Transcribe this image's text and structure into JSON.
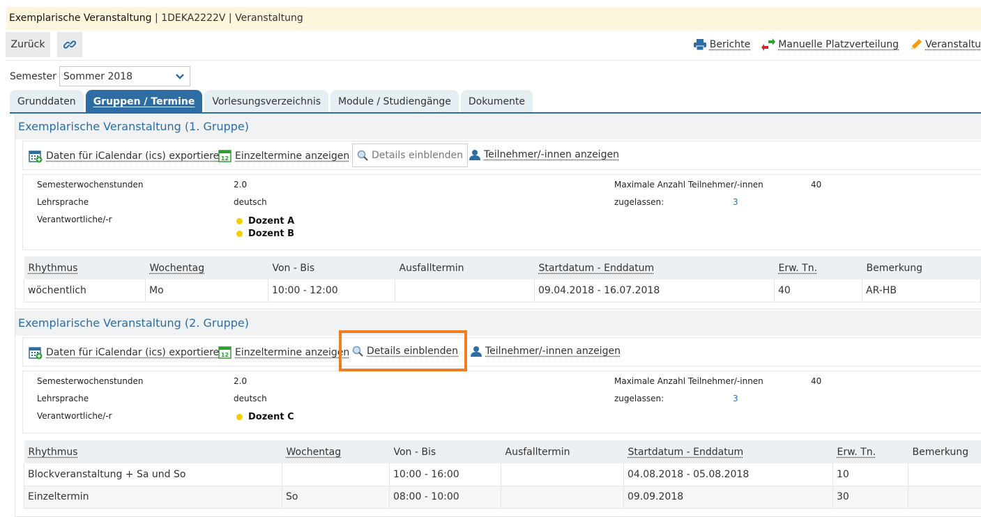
{
  "title": {
    "name": "Exemplarische Veranstaltung",
    "separator": "|",
    "code": "1DEKA2222V",
    "separator2": "|",
    "type": "Veranstaltung"
  },
  "toolbar": {
    "back_label": "Zurück",
    "link_icon": "link-icon",
    "actions": [
      {
        "label": "Berichte",
        "icon": "printer-icon"
      },
      {
        "label": "Manuelle Platzverteilung",
        "icon": "swap-arrows-icon"
      },
      {
        "label": "Veranstaltu",
        "icon": "pencil-icon"
      }
    ]
  },
  "semester": {
    "label": "Semester",
    "selected": "Sommer 2018"
  },
  "tabs": [
    "Grunddaten",
    "Gruppen / Termine",
    "Vorlesungsverzeichnis",
    "Module / Studiengänge",
    "Dokumente"
  ],
  "active_tab": "Gruppen / Termine",
  "colors": {
    "accent": "#2e6da4",
    "highlight": "#f07d22",
    "title_bg": "#fbf6dc",
    "dot": "#f3cf00"
  },
  "links": {
    "ical": "Daten für iCalendar (ics) exportieren",
    "einzeltermine": "Einzeltermine anzeigen",
    "details": "Details einblenden",
    "teilnehmer": "Teilnehmer/-innen anzeigen"
  },
  "info_labels": {
    "sws": "Semesterwochenstunden",
    "sprache": "Lehrsprache",
    "verantwortlich": "Verantwortliche/-r",
    "max": "Maximale Anzahl Teilnehmer/-innen",
    "zugelassen": "zugelassen:"
  },
  "table_headers": [
    "Rhythmus",
    "Wochentag",
    "Von - Bis",
    "Ausfalltermin",
    "Startdatum - Enddatum",
    "Erw. Tn.",
    "Bemerkung"
  ],
  "groups": [
    {
      "title": "Exemplarische Veranstaltung (1. Gruppe)",
      "sws": "2.0",
      "sprache": "deutsch",
      "dozenten": [
        "Dozent A",
        "Dozent B"
      ],
      "max": "40",
      "zugelassen": "3",
      "rows": [
        [
          "wöchentlich",
          "Mo",
          "10:00 - 12:00",
          "",
          "09.04.2018 - 16.07.2018",
          "40",
          "AR-HB"
        ]
      ]
    },
    {
      "title": "Exemplarische Veranstaltung (2. Gruppe)",
      "sws": "2.0",
      "sprache": "deutsch",
      "dozenten": [
        "Dozent C"
      ],
      "max": "40",
      "zugelassen": "3",
      "rows": [
        [
          "Blockveranstaltung + Sa und So",
          "",
          "10:00 - 16:00",
          "",
          "04.08.2018 - 05.08.2018",
          "10",
          ""
        ],
        [
          "Einzeltermin",
          "So",
          "08:00 - 10:00",
          "",
          "09.09.2018",
          "30",
          ""
        ]
      ]
    }
  ]
}
